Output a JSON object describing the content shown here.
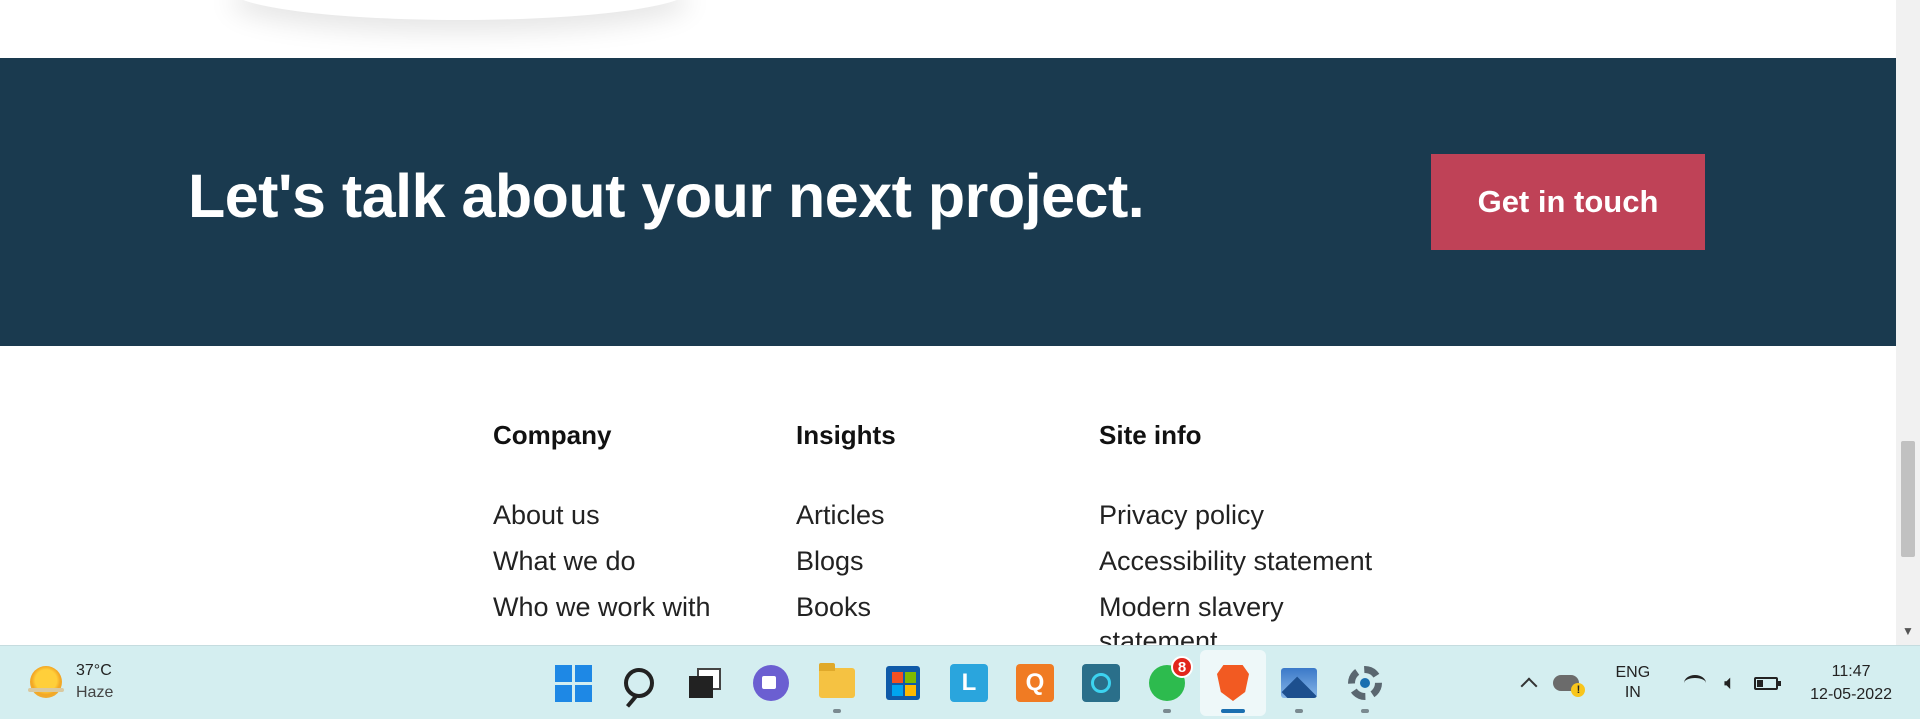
{
  "cta": {
    "title": "Let's talk about your next project.",
    "button_label": "Get in touch",
    "background": "#1a3a4f",
    "button_color": "#bf4257"
  },
  "footer": {
    "columns": [
      {
        "heading": "Company",
        "links": [
          "About us",
          "What we do",
          "Who we work with"
        ]
      },
      {
        "heading": "Insights",
        "links": [
          "Articles",
          "Blogs",
          "Books"
        ]
      },
      {
        "heading": "Site info",
        "links": [
          "Privacy policy",
          "Accessibility statement",
          "Modern slavery statement"
        ]
      }
    ]
  },
  "taskbar": {
    "weather": {
      "temp": "37°C",
      "condition": "Haze",
      "icon": "sun-haze-icon"
    },
    "apps": [
      {
        "name": "start",
        "icon": "windows-logo-icon"
      },
      {
        "name": "search",
        "icon": "search-icon"
      },
      {
        "name": "task-view",
        "icon": "task-view-icon"
      },
      {
        "name": "teams-chat",
        "icon": "video-chat-icon"
      },
      {
        "name": "file-explorer",
        "icon": "folder-icon"
      },
      {
        "name": "store",
        "icon": "store-icon"
      },
      {
        "name": "l-app",
        "icon": "l-app-icon",
        "letter": "L"
      },
      {
        "name": "q-app",
        "icon": "q-app-icon",
        "letter": "Q"
      },
      {
        "name": "alexa",
        "icon": "alexa-icon"
      },
      {
        "name": "whatsapp",
        "icon": "whatsapp-icon",
        "badge": "8"
      },
      {
        "name": "brave",
        "icon": "brave-browser-icon"
      },
      {
        "name": "photos",
        "icon": "photos-icon"
      },
      {
        "name": "settings",
        "icon": "gear-icon"
      }
    ],
    "tray": {
      "language_top": "ENG",
      "language_bottom": "IN",
      "time": "11:47",
      "date": "12-05-2022"
    }
  }
}
